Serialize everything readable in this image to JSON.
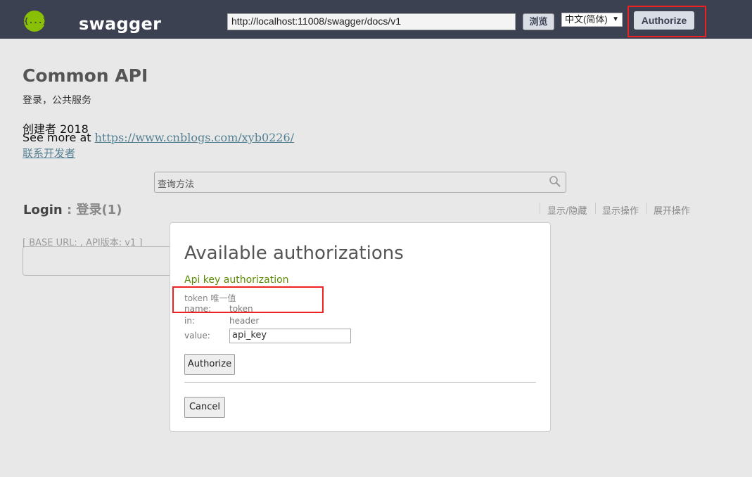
{
  "header": {
    "logo_glyph": "{...}",
    "brand": "swagger",
    "url_value": "http://localhost:11008/swagger/docs/v1",
    "explore_label": "浏览",
    "lang_selected": "中文(简体)",
    "authorize_label": "Authorize"
  },
  "info": {
    "title": "Common API",
    "description": "登录，公共服务",
    "creator": "创建者 2018",
    "see_more_prefix": "See more at ",
    "see_more_link": "https://www.cnblogs.com/xyb0226/",
    "contact": "联系开发者"
  },
  "search": {
    "placeholder": "查询方法"
  },
  "resource": {
    "name": "Login",
    "separator": " : ",
    "sub": "登录(1)",
    "ops": [
      "显示/隐藏",
      "显示操作",
      "展开操作"
    ]
  },
  "base_url": {
    "text": "[ BASE URL: , API版本: v1 ]"
  },
  "modal": {
    "title": "Available authorizations",
    "auth_type": "Api key authorization",
    "description": "token 唯一值",
    "name_label": "name:",
    "name_value": "token",
    "in_label": "in:",
    "in_value": "header",
    "value_label": "value:",
    "value_input": "api_key",
    "authorize_label": "Authorize",
    "cancel_label": "Cancel"
  },
  "colors": {
    "header_bg": "#3b4151",
    "logo_green": "#89bf04",
    "highlight_red": "#e22"
  }
}
